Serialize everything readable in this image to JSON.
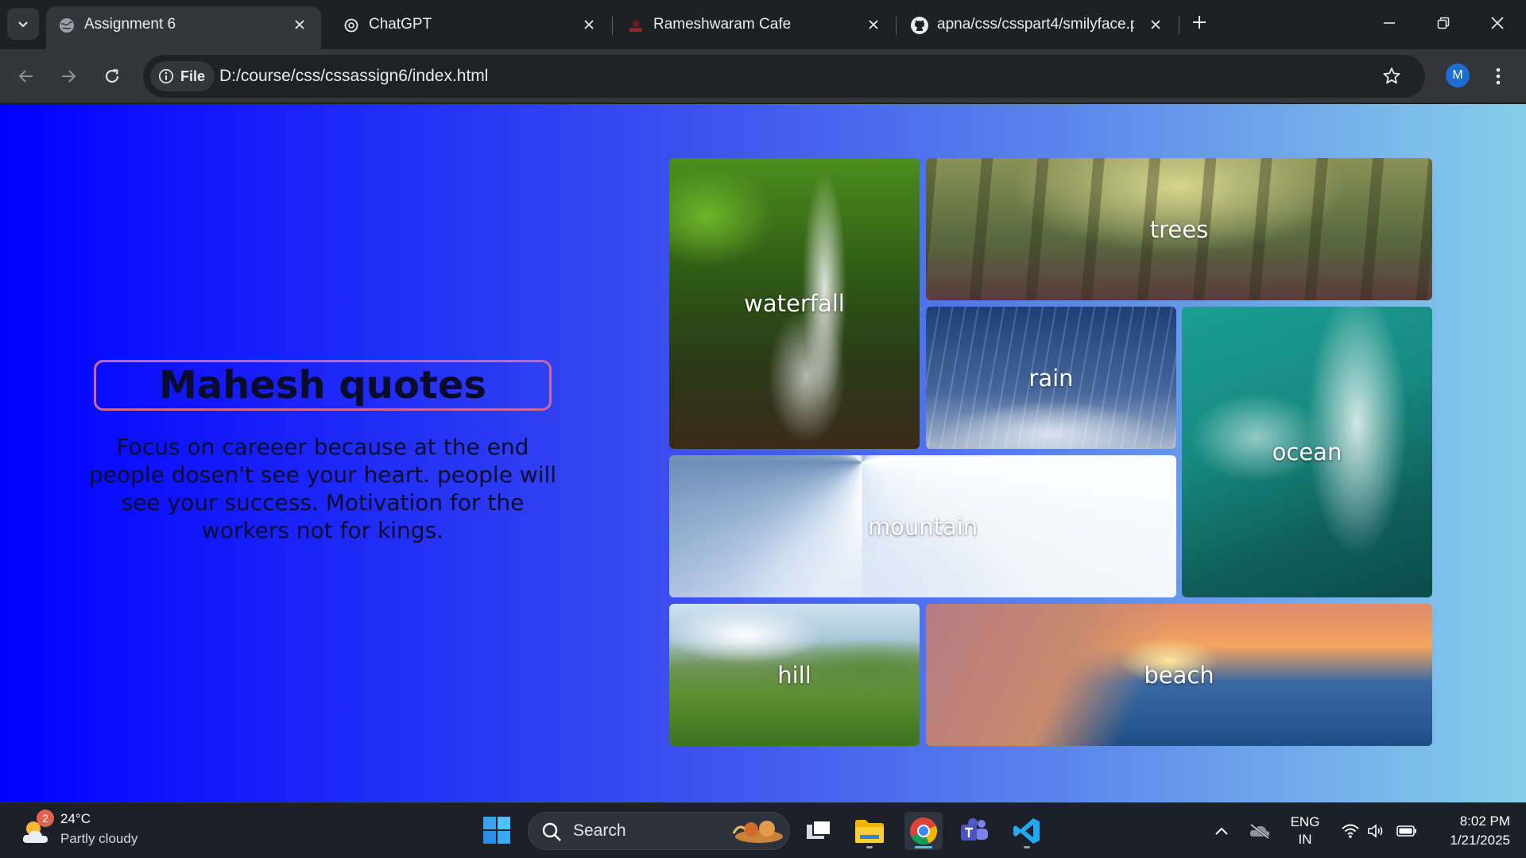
{
  "browser": {
    "tabs": [
      {
        "title": "Assignment 6",
        "active": true,
        "icon": "globe-icon"
      },
      {
        "title": "ChatGPT",
        "active": false,
        "icon": "chatgpt-icon"
      },
      {
        "title": "Rameshwaram Cafe",
        "active": false,
        "icon": "cafe-favicon-icon"
      },
      {
        "title": "apna/css/csspart4/smilyface.png",
        "active": false,
        "icon": "github-icon"
      }
    ],
    "address": {
      "chip_label": "File",
      "url": "D:/course/css/cssassign6/index.html"
    },
    "profile_initial": "M"
  },
  "page": {
    "heading": "Mahesh quotes",
    "quote": "Focus on careeer because at the end people dosen't see your heart. people will see your success. Motivation for the workers not for kings.",
    "gallery": [
      {
        "label": "waterfall"
      },
      {
        "label": "trees"
      },
      {
        "label": "rain"
      },
      {
        "label": "ocean"
      },
      {
        "label": "mountain"
      },
      {
        "label": "hill"
      },
      {
        "label": "beach"
      }
    ],
    "colors": {
      "gradient_start": "#0000ff",
      "gradient_end": "#87cde8",
      "heading_border": "#c86a9a"
    }
  },
  "taskbar": {
    "weather": {
      "temp": "24°C",
      "condition": "Partly cloudy",
      "badge": "2"
    },
    "search_label": "Search",
    "language": {
      "line1": "ENG",
      "line2": "IN"
    },
    "clock": {
      "time": "8:02 PM",
      "date": "1/21/2025"
    }
  }
}
